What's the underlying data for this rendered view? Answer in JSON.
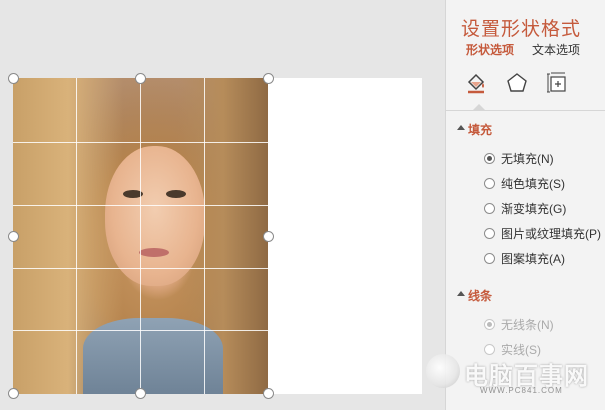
{
  "panel": {
    "title": "设置形状格式",
    "tabs": [
      {
        "label": "形状选项",
        "active": true
      },
      {
        "label": "文本选项",
        "active": false
      }
    ],
    "icons": [
      "fill-line-icon",
      "effects-pentagon-icon",
      "size-properties-icon"
    ],
    "accent_color": "#c55a3c"
  },
  "fill_section": {
    "title": "填充",
    "options": [
      {
        "label": "无填充(N)",
        "checked": true
      },
      {
        "label": "纯色填充(S)",
        "checked": false
      },
      {
        "label": "渐变填充(G)",
        "checked": false
      },
      {
        "label": "图片或纹理填充(P)",
        "checked": false
      },
      {
        "label": "图案填充(A)",
        "checked": false
      }
    ]
  },
  "line_section": {
    "title": "线条",
    "options": [
      {
        "label": "无线条(N)",
        "checked": true,
        "disabled": true
      },
      {
        "label": "实线(S)",
        "checked": false,
        "disabled": true
      }
    ]
  },
  "watermark": {
    "text": "电脑百事网",
    "url": "WWW.PC841.COM"
  }
}
